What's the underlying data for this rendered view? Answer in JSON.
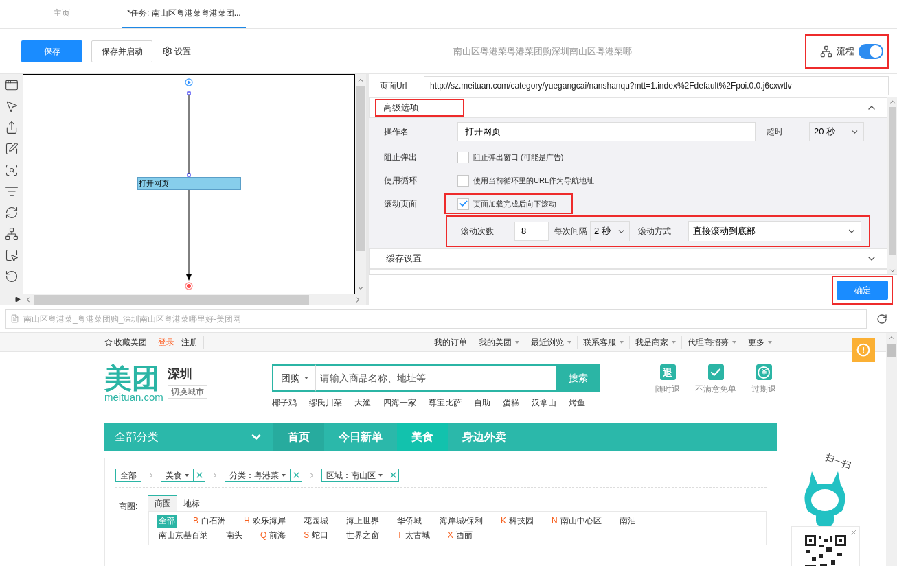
{
  "tabs": [
    {
      "label": "主页",
      "selected": false
    },
    {
      "label": "*任务: 南山区粤港菜粤港菜团...",
      "selected": true
    }
  ],
  "toolbar": {
    "save": "保存",
    "save_start": "保存并启动",
    "settings": "设置",
    "task_title": "南山区粤港菜粤港菜团购深圳南山区粤港菜哪",
    "flow_label": "流程",
    "flow_on": true,
    "flow_highlighted": true
  },
  "workflow": {
    "node": "打开网页"
  },
  "options": {
    "url_label": "页面Url",
    "url": "http://sz.meituan.com/category/yuegangcai/nanshanqu?mtt=1.index%2Fdefault%2Fpoi.0.0.j6cxwtlv",
    "advanced": {
      "title": "高级选项",
      "expanded": true,
      "highlighted": true
    },
    "action_name_label": "操作名",
    "action_name": "打开网页",
    "timeout_label": "超时",
    "timeout": "20 秒",
    "rows": [
      {
        "label": "阻止弹出",
        "text": "阻止弹出窗口 (可能是广告)",
        "checked": false,
        "highlighted": false
      },
      {
        "label": "使用循环",
        "text": "使用当前循环里的URL作为导航地址",
        "checked": false,
        "highlighted": false
      },
      {
        "label": "滚动页面",
        "text": "页面加载完成后向下滚动",
        "checked": true,
        "highlighted": true
      }
    ],
    "scroll": {
      "count_label": "滚动次数",
      "count": "8",
      "interval_label": "每次间隔",
      "interval": "2 秒",
      "mode_label": "滚动方式",
      "mode": "直接滚动到底部",
      "highlighted": true
    },
    "cache": {
      "title": "缓存设置",
      "expanded": false
    },
    "ok": "确定",
    "ok_highlighted": true
  },
  "browser": {
    "address": "南山区粤港菜_粤港菜团购_深圳南山区粤港菜哪里好-美团网"
  },
  "site": {
    "topbar": {
      "favorite": "收藏美团",
      "login": "登录",
      "register": "注册",
      "menus": [
        {
          "label": "我的订单",
          "dropdown": false
        },
        {
          "label": "我的美团",
          "dropdown": true
        },
        {
          "label": "最近浏览",
          "dropdown": true
        },
        {
          "label": "联系客服",
          "dropdown": true
        },
        {
          "label": "我是商家",
          "dropdown": true
        },
        {
          "label": "代理商招募",
          "dropdown": true
        },
        {
          "label": "更多",
          "dropdown": true
        }
      ]
    },
    "logo": {
      "mark": "美团",
      "domain": "meituan.com"
    },
    "city": "深圳",
    "switch_city": "切换城市",
    "search": {
      "scope": "团购",
      "placeholder": "请输入商品名称、地址等",
      "button": "搜索"
    },
    "hot": [
      "椰子鸡",
      "缪氏川菜",
      "大渔",
      "四海一家",
      "尊宝比萨",
      "自助",
      "蛋糕",
      "汉拿山",
      "烤鱼"
    ],
    "promises": [
      {
        "kind": "glyph",
        "glyph": "退",
        "label": "随时退"
      },
      {
        "kind": "check",
        "label": "不满意免单"
      },
      {
        "kind": "yen",
        "label": "过期退"
      }
    ],
    "nav": {
      "all": "全部分类",
      "items": [
        {
          "label": "首页",
          "selected": false
        },
        {
          "label": "今日新单",
          "selected": false
        },
        {
          "label": "美食",
          "selected": true
        },
        {
          "label": "身边外卖",
          "selected": false
        }
      ]
    },
    "filters": [
      {
        "label": "全部",
        "dropdown": false,
        "removable": false
      },
      {
        "label": "美食",
        "dropdown": true,
        "removable": true
      },
      {
        "label": "分类：粤港菜",
        "dropdown": true,
        "removable": true
      },
      {
        "label": "区域：南山区",
        "dropdown": true,
        "removable": true
      }
    ],
    "district": {
      "label": "商圈:",
      "tabs": [
        {
          "label": "商圈",
          "selected": true
        },
        {
          "label": "地标",
          "selected": false
        }
      ],
      "area_rows": [
        [
          {
            "name": "全部",
            "selected": true
          },
          {
            "letter": "B",
            "name": "白石洲",
            "selected": false
          },
          {
            "letter": "H",
            "name": "欢乐海岸",
            "selected": false
          },
          {
            "name": "花园城",
            "selected": false
          },
          {
            "name": "海上世界",
            "selected": false
          },
          {
            "name": "华侨城",
            "selected": false
          },
          {
            "name": "海岸城/保利",
            "selected": false
          },
          {
            "letter": "K",
            "name": "科技园",
            "selected": false
          },
          {
            "letter": "N",
            "name": "南山中心区",
            "selected": false
          },
          {
            "name": "南油",
            "selected": false
          }
        ],
        [
          {
            "name": "南山京基百纳",
            "selected": false
          },
          {
            "name": "南头",
            "selected": false
          },
          {
            "letter": "Q",
            "name": "前海",
            "selected": false
          },
          {
            "letter": "S",
            "name": "蛇口",
            "selected": false
          },
          {
            "name": "世界之窗",
            "selected": false
          },
          {
            "letter": "T",
            "name": "太古城",
            "selected": false
          },
          {
            "letter": "X",
            "name": "西丽",
            "selected": false
          }
        ]
      ]
    },
    "mascot_caption": "扫一扫"
  }
}
